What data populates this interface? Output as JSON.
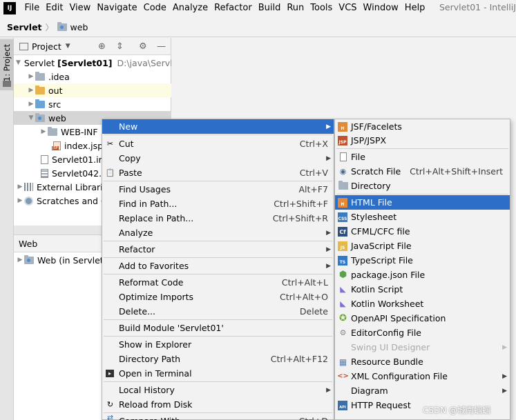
{
  "menubar": {
    "logo": "IJ",
    "items": [
      "File",
      "Edit",
      "View",
      "Navigate",
      "Code",
      "Analyze",
      "Refactor",
      "Build",
      "Run",
      "Tools",
      "VCS",
      "Window",
      "Help"
    ],
    "window_title": "Servlet01 - IntelliJ I"
  },
  "breadcrumb": {
    "project": "Servlet",
    "folder": "web"
  },
  "side": {
    "project_tab": "1: Project"
  },
  "project_panel": {
    "title": "Project",
    "tree": [
      {
        "label": "Servlet",
        "bold": "[Servlet01]",
        "path": "D:\\java\\Servl"
      },
      {
        "label": ".idea"
      },
      {
        "label": "out"
      },
      {
        "label": "src"
      },
      {
        "label": "web"
      },
      {
        "label": "WEB-INF"
      },
      {
        "label": "index.jsp"
      },
      {
        "label": "Servlet01.im"
      },
      {
        "label": "Servlet042.z"
      },
      {
        "label": "External Librari"
      },
      {
        "label": "Scratches and C"
      }
    ]
  },
  "web_panel": {
    "title": "Web",
    "item": "Web (in Servlet"
  },
  "context_menu": {
    "items": [
      {
        "label": "New"
      },
      {
        "label": "Cut",
        "shortcut": "Ctrl+X"
      },
      {
        "label": "Copy"
      },
      {
        "label": "Paste",
        "shortcut": "Ctrl+V"
      },
      {
        "label": "Find Usages",
        "shortcut": "Alt+F7"
      },
      {
        "label": "Find in Path...",
        "shortcut": "Ctrl+Shift+F"
      },
      {
        "label": "Replace in Path...",
        "shortcut": "Ctrl+Shift+R"
      },
      {
        "label": "Analyze"
      },
      {
        "label": "Refactor"
      },
      {
        "label": "Add to Favorites"
      },
      {
        "label": "Reformat Code",
        "shortcut": "Ctrl+Alt+L"
      },
      {
        "label": "Optimize Imports",
        "shortcut": "Ctrl+Alt+O"
      },
      {
        "label": "Delete...",
        "shortcut": "Delete"
      },
      {
        "label": "Build Module 'Servlet01'"
      },
      {
        "label": "Show in Explorer"
      },
      {
        "label": "Directory Path",
        "shortcut": "Ctrl+Alt+F12"
      },
      {
        "label": "Open in Terminal"
      },
      {
        "label": "Local History"
      },
      {
        "label": "Reload from Disk"
      },
      {
        "label": "Compare With...",
        "shortcut": "Ctrl+D"
      }
    ]
  },
  "new_submenu": {
    "items": [
      {
        "label": "JSF/Facelets"
      },
      {
        "label": "JSP/JSPX"
      },
      {
        "label": "File"
      },
      {
        "label": "Scratch File",
        "shortcut": "Ctrl+Alt+Shift+Insert"
      },
      {
        "label": "Directory"
      },
      {
        "label": "HTML File"
      },
      {
        "label": "Stylesheet"
      },
      {
        "label": "CFML/CFC file"
      },
      {
        "label": "JavaScript File"
      },
      {
        "label": "TypeScript File"
      },
      {
        "label": "package.json File"
      },
      {
        "label": "Kotlin Script"
      },
      {
        "label": "Kotlin Worksheet"
      },
      {
        "label": "OpenAPI Specification"
      },
      {
        "label": "EditorConfig File"
      },
      {
        "label": "Swing UI Designer"
      },
      {
        "label": "Resource Bundle"
      },
      {
        "label": "XML Configuration File"
      },
      {
        "label": "Diagram"
      },
      {
        "label": "HTTP Request"
      }
    ]
  },
  "watermark": "CSDN @城南蝈蝈",
  "colors": {
    "highlight": "#2c6ec8",
    "menu_bg": "#f2f2f2",
    "selected_row": "#d5d5d5",
    "out_row": "#fdfbe2"
  }
}
